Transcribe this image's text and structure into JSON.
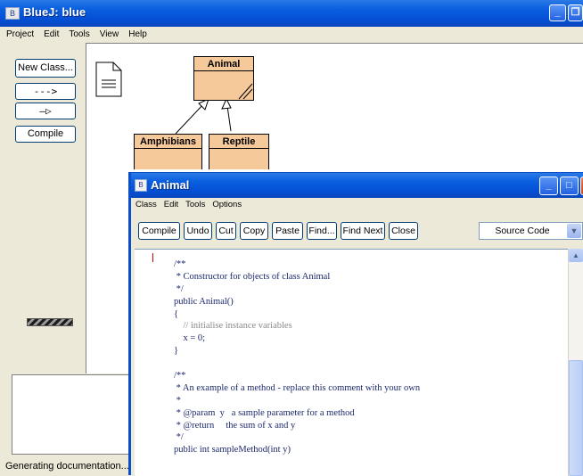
{
  "window": {
    "title": "BlueJ:  blue"
  },
  "menubar": [
    "Project",
    "Edit",
    "Tools",
    "View",
    "Help"
  ],
  "sidebar": {
    "new_class": "New Class...",
    "uses_arrow": "--->",
    "inherit_arrow": "—▷",
    "compile": "Compile"
  },
  "diagram": {
    "classes": [
      {
        "name": "Animal"
      },
      {
        "name": "Amphibians"
      },
      {
        "name": "Reptile"
      }
    ]
  },
  "status": {
    "text": "Generating documentation..."
  },
  "editor": {
    "title": "Animal",
    "menu": [
      "Class",
      "Edit",
      "Tools",
      "Options"
    ],
    "toolbar": [
      "Compile",
      "Undo",
      "Cut",
      "Copy",
      "Paste",
      "Find...",
      "Find Next",
      "Close"
    ],
    "view_selector": "Source Code",
    "code": [
      "/**",
      " * Constructor for objects of class Animal",
      " */",
      "public Animal()",
      "{",
      "    // initialise instance variables",
      "    x = 0;",
      "}",
      "",
      "/**",
      " * An example of a method - replace this comment with your own",
      " *",
      " * @param  y   a sample parameter for a method",
      " * @return     the sum of x and y",
      " */",
      "public int sampleMethod(int y)"
    ]
  }
}
